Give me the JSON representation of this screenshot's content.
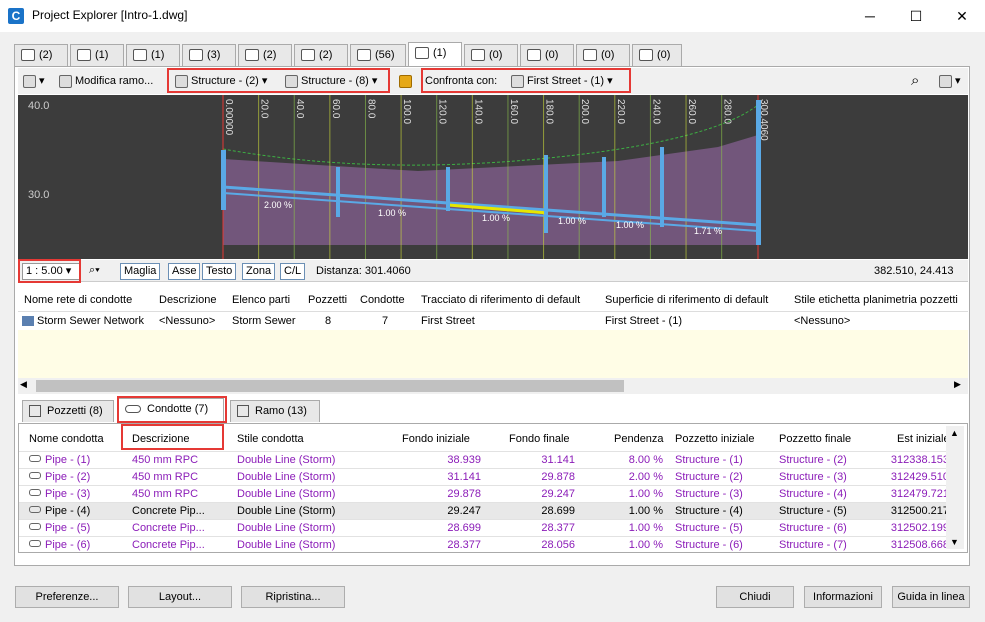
{
  "window": {
    "title": "Project Explorer [Intro-1.dwg]",
    "minimize": "─",
    "maximize": "☐",
    "close": "✕"
  },
  "top_tabs": [
    "(2)",
    "(1)",
    "(1)",
    "(3)",
    "(2)",
    "(2)",
    "(56)",
    "(1)",
    "(0)",
    "(0)",
    "(0)",
    "(0)"
  ],
  "toolbar": {
    "edit_branch": "Modifica ramo...",
    "structure_a": "Structure - (2)",
    "structure_b": "Structure - (8)",
    "compare_label": "Confronta con:",
    "compare_value": "First Street - (1)"
  },
  "profile": {
    "y_top": "40.0",
    "y_mid": "30.0",
    "stations": [
      "0.00000",
      "20.0",
      "40.0",
      "60.0",
      "80.0",
      "100.0",
      "120.0",
      "140.0",
      "160.0",
      "180.0",
      "200.0",
      "220.0",
      "240.0",
      "260.0",
      "280.0",
      "300.4060"
    ],
    "slopes": [
      "2.00 %",
      "1.00 %",
      "1.00 %",
      "1.00 %",
      "1.00 %",
      "1.71 %"
    ]
  },
  "profile_bar": {
    "scale": "1 : 5.00",
    "buttons": [
      "Maglia",
      "Asse",
      "Testo",
      "Zona",
      "C/L"
    ],
    "distance": "Distanza: 301.4060",
    "coords": "382.510, 24.413"
  },
  "network": {
    "headers": [
      "Nome rete di condotte",
      "Descrizione",
      "Elenco parti",
      "Pozzetti",
      "Condotte",
      "Tracciato di riferimento di default",
      "Superficie di riferimento di default",
      "Stile etichetta planimetria pozzetti"
    ],
    "row": [
      "Storm Sewer Network",
      "<Nessuno>",
      "Storm Sewer",
      "8",
      "7",
      "First Street",
      "First Street - (1)",
      "<Nessuno>"
    ]
  },
  "bottom_tabs": [
    "Pozzetti (8)",
    "Condotte (7)",
    "Ramo (13)"
  ],
  "pipes": {
    "headers": [
      "Nome condotta",
      "Descrizione",
      "Stile condotta",
      "Fondo iniziale",
      "Fondo finale",
      "Pendenza",
      "Pozzetto iniziale",
      "Pozzetto finale",
      "Est iniziale"
    ],
    "rows": [
      [
        "Pipe - (1)",
        "450 mm RPC",
        "Double Line (Storm)",
        "38.939",
        "31.141",
        "8.00 %",
        "Structure - (1)",
        "Structure - (2)",
        "312338.153"
      ],
      [
        "Pipe - (2)",
        "450 mm RPC",
        "Double Line (Storm)",
        "31.141",
        "29.878",
        "2.00 %",
        "Structure - (2)",
        "Structure - (3)",
        "312429.510"
      ],
      [
        "Pipe - (3)",
        "450 mm RPC",
        "Double Line (Storm)",
        "29.878",
        "29.247",
        "1.00 %",
        "Structure - (3)",
        "Structure - (4)",
        "312479.721"
      ],
      [
        "Pipe - (4)",
        "Concrete Pip...",
        "Double Line (Storm)",
        "29.247",
        "28.699",
        "1.00 %",
        "Structure - (4)",
        "Structure - (5)",
        "312500.217"
      ],
      [
        "Pipe - (5)",
        "Concrete Pip...",
        "Double Line (Storm)",
        "28.699",
        "28.377",
        "1.00 %",
        "Structure - (5)",
        "Structure - (6)",
        "312502.199"
      ],
      [
        "Pipe - (6)",
        "Concrete Pip...",
        "Double Line (Storm)",
        "28.377",
        "28.056",
        "1.00 %",
        "Structure - (6)",
        "Structure - (7)",
        "312508.668"
      ]
    ]
  },
  "footer": {
    "prefs": "Preferenze...",
    "layout": "Layout...",
    "restore": "Ripristina...",
    "close": "Chiudi",
    "info": "Informazioni",
    "help": "Guida in linea"
  }
}
